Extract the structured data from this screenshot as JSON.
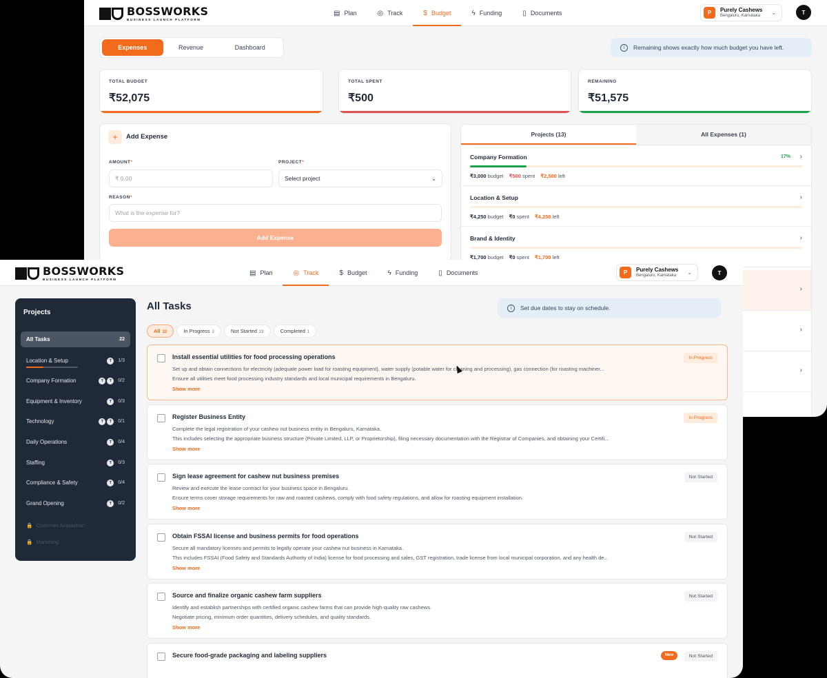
{
  "brand": {
    "name": "BOSSWORKS",
    "tagline": "BUSINESS LAUNCH PLATFORM"
  },
  "nav": [
    {
      "label": "Plan",
      "icon": "clipboard-icon"
    },
    {
      "label": "Track",
      "icon": "check-circle-icon"
    },
    {
      "label": "Budget",
      "icon": "dollar-icon"
    },
    {
      "label": "Funding",
      "icon": "bolt-icon"
    },
    {
      "label": "Documents",
      "icon": "document-icon"
    }
  ],
  "company": {
    "initial": "P",
    "name": "Purely Cashews",
    "location": "Bengaluru, Karnataka"
  },
  "user": {
    "initial": "T"
  },
  "budget": {
    "active_nav": "Budget",
    "tabs": [
      "Expenses",
      "Revenue",
      "Dashboard"
    ],
    "info": "Remaining shows exactly how much budget you have left.",
    "kpis": [
      {
        "label": "TOTAL BUDGET",
        "value": "₹52,075",
        "color": "#f26b1d"
      },
      {
        "label": "TOTAL SPENT",
        "value": "₹500",
        "color": "#e05252"
      },
      {
        "label": "REMAINING",
        "value": "₹51,575",
        "color": "#16a34a"
      }
    ],
    "add_expense": {
      "title": "Add Expense",
      "amount_label": "AMOUNT",
      "amount_placeholder": "₹ 0.00",
      "project_label": "PROJECT",
      "project_value": "Select project",
      "reason_label": "REASON",
      "reason_placeholder": "What is the expense for?",
      "button": "Add Expense",
      "required_mark": "*"
    },
    "project_tabs": [
      "Projects (13)",
      "All Expenses (1)"
    ],
    "projects": [
      {
        "name": "Company Formation",
        "progress": 0.17,
        "progress_label": "17%",
        "budget": "₹3,000",
        "spent": "₹500",
        "left": "₹2,500"
      },
      {
        "name": "Location & Setup",
        "progress": 0,
        "progress_label": "",
        "budget": "₹4,250",
        "spent": "₹0",
        "left": "₹4,250"
      },
      {
        "name": "Brand & Identity",
        "progress": 0,
        "progress_label": "",
        "budget": "₹1,700",
        "spent": "₹0",
        "left": "₹1,700"
      }
    ],
    "word_budget": "budget",
    "word_spent": "spent",
    "word_left": "left"
  },
  "track": {
    "active_nav": "Track",
    "sidebar_title": "Projects",
    "sidebar_items": [
      {
        "label": "All Tasks",
        "count": "22",
        "avatars": []
      },
      {
        "label": "Location & Setup",
        "count": "1/3",
        "avatars": [
          "T"
        ],
        "progress": 0.33
      },
      {
        "label": "Company Formation",
        "count": "0/2",
        "avatars": [
          "T",
          "T"
        ]
      },
      {
        "label": "Equipment & Inventory",
        "count": "0/3",
        "avatars": [
          "T"
        ]
      },
      {
        "label": "Technology",
        "count": "0/1",
        "avatars": [
          "T",
          "T"
        ]
      },
      {
        "label": "Daily Operations",
        "count": "0/4",
        "avatars": [
          "T"
        ]
      },
      {
        "label": "Staffing",
        "count": "0/3",
        "avatars": [
          "T"
        ]
      },
      {
        "label": "Compliance & Safety",
        "count": "0/4",
        "avatars": [
          "T"
        ]
      },
      {
        "label": "Grand Opening",
        "count": "0/2",
        "avatars": [
          "T"
        ]
      }
    ],
    "locked_items": [
      "Customer Acquisition",
      "Marketing"
    ],
    "title": "All Tasks",
    "info": "Set due dates to stay on schedule.",
    "filters": [
      {
        "label": "All",
        "count": "22"
      },
      {
        "label": "In Progress",
        "count": "2"
      },
      {
        "label": "Not Started",
        "count": "19"
      },
      {
        "label": "Completed",
        "count": "1"
      }
    ],
    "show_more": "Show more",
    "tasks": [
      {
        "title": "Install essential utilities for food processing operations",
        "status": "In Progress",
        "line1": "Set up and obtain connections for electricity (adequate power load for roasting equipment), water supply (potable water for cleaning and processing), gas connection (for roasting machiner...",
        "line2": "Ensure all utilities meet food processing industry standards and local municipal requirements in Bengaluru."
      },
      {
        "title": "Register Business Entity",
        "status": "In Progress",
        "line1": "Complete the legal registration of your cashew nut business entity in Bengaluru, Karnataka.",
        "line2": "This includes selecting the appropriate business structure (Private Limited, LLP, or Proprietorship), filing necessary documentation with the Registrar of Companies, and obtaining your Certifi..."
      },
      {
        "title": "Sign lease agreement for cashew nut business premises",
        "status": "Not Started",
        "line1": "Review and execute the lease contract for your business space in Bengaluru.",
        "line2": "Ensure terms cover storage requirements for raw and roasted cashews, comply with food safety regulations, and allow for roasting equipment installation."
      },
      {
        "title": "Obtain FSSAI license and business permits for food operations",
        "status": "Not Started",
        "line1": "Secure all mandatory licenses and permits to legally operate your cashew nut business in Karnataka.",
        "line2": "This includes FSSAI (Food Safety and Standards Authority of India) license for food processing and sales, GST registration, trade license from local municipal corporation, and any health de..."
      },
      {
        "title": "Source and finalize organic cashew farm suppliers",
        "status": "Not Started",
        "line1": "Identify and establish partnerships with certified organic cashew farms that can provide high-quality raw cashews.",
        "line2": "Negotiate pricing, minimum order quantities, delivery schedules, and quality standards."
      },
      {
        "title": "Secure food-grade packaging and labeling suppliers",
        "status": "Not Started",
        "badge": "New",
        "line1": "",
        "line2": ""
      }
    ]
  }
}
